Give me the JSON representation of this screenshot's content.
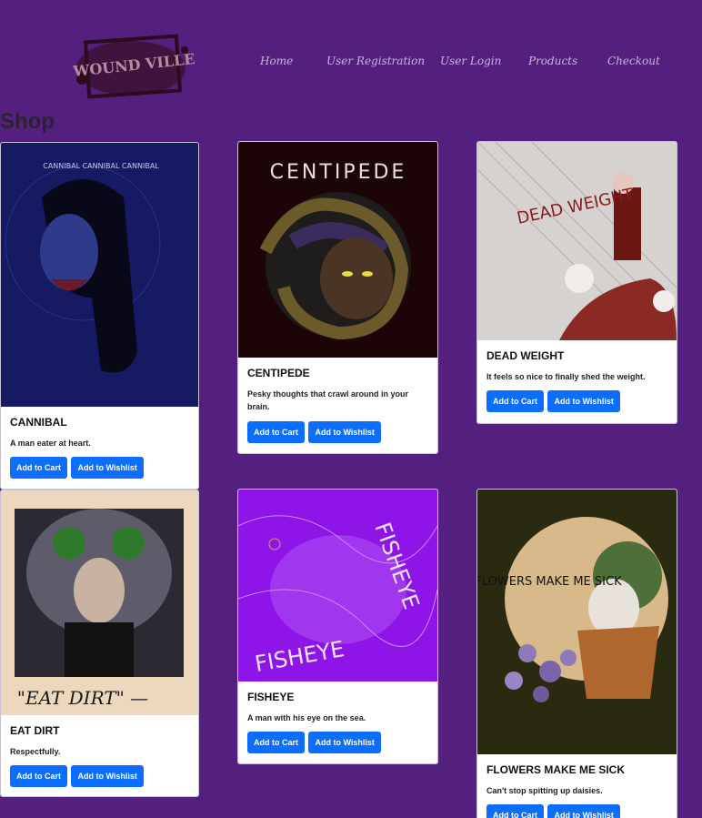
{
  "brand": {
    "logo_text": "WOUND VILLE"
  },
  "nav": [
    {
      "label": "Home"
    },
    {
      "label": "User Registration"
    },
    {
      "label": "User Login"
    },
    {
      "label": "Products"
    },
    {
      "label": "Checkout"
    }
  ],
  "page": {
    "title": "Shop"
  },
  "buttons": {
    "add_to_cart": "Add to Cart",
    "add_to_wishlist": "Add to Wishlist"
  },
  "products": [
    {
      "title": "CANNIBAL",
      "description": "A man eater at heart.",
      "art_text": "CANNIBAL CANNIBAL CANNIBAL"
    },
    {
      "title": "CENTIPEDE",
      "description": "Pesky thoughts that crawl around in your brain.",
      "art_text": "CENTIPEDE"
    },
    {
      "title": "DEAD WEIGHT",
      "description": "It feels so nice to finally shed the weight.",
      "art_text": "DEAD WEIGHT"
    },
    {
      "title": "EAT DIRT",
      "description": "Respectfully.",
      "art_text": "\"EAT DIRT\" —"
    },
    {
      "title": "FISHEYE",
      "description": "A man with his eye on the sea.",
      "art_text": "FISHEYE"
    },
    {
      "title": "FLOWERS MAKE ME SICK",
      "description": "Can't stop spitting up daisies.",
      "art_text": "FLOWERS MAKE ME SICK"
    }
  ]
}
